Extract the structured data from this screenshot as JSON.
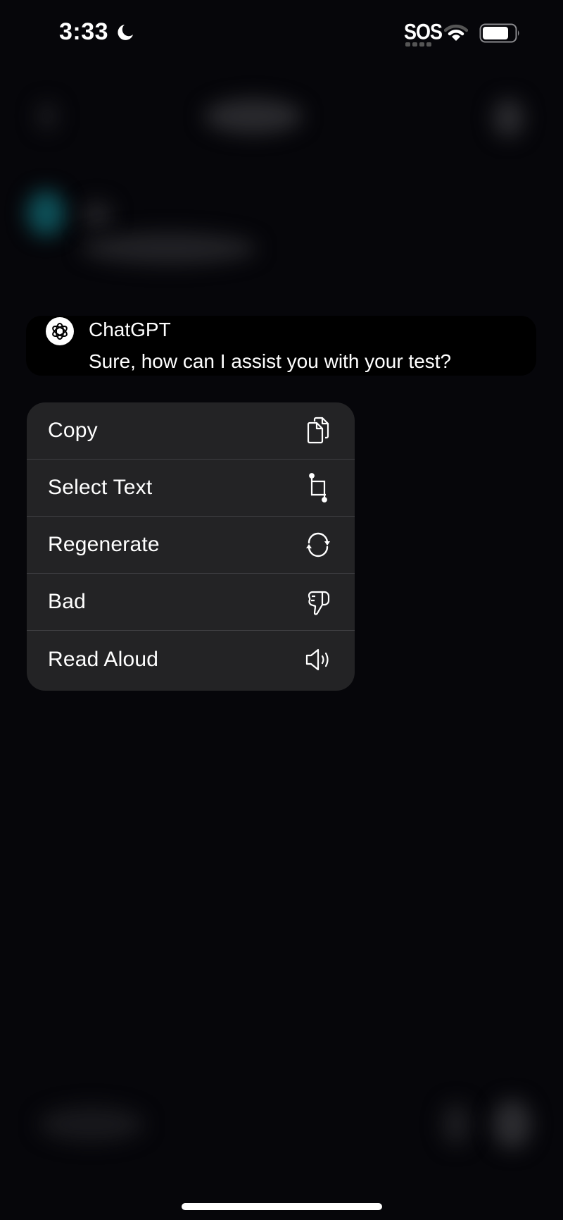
{
  "status_bar": {
    "time": "3:33",
    "focus_icon": "moon-icon",
    "carrier_text": "SOS",
    "wifi_icon": "wifi-icon",
    "battery_icon": "battery-icon"
  },
  "background": {
    "description": "blurred chat screen behind context menu",
    "accent_color": "#0e5058"
  },
  "message": {
    "sender": "ChatGPT",
    "avatar_icon": "openai-logo-icon",
    "text": "Sure, how can I assist you with your test?"
  },
  "context_menu": {
    "items": [
      {
        "label": "Copy",
        "icon": "copy-icon"
      },
      {
        "label": "Select Text",
        "icon": "crop-select-icon"
      },
      {
        "label": "Regenerate",
        "icon": "regenerate-icon"
      },
      {
        "label": "Bad",
        "icon": "thumbs-down-icon"
      },
      {
        "label": "Read Aloud",
        "icon": "speaker-icon"
      }
    ]
  },
  "colors": {
    "background": "#06060a",
    "menu_background": "#232325",
    "separator": "#3e3e42",
    "bubble": "#000000",
    "text": "#ffffff"
  }
}
